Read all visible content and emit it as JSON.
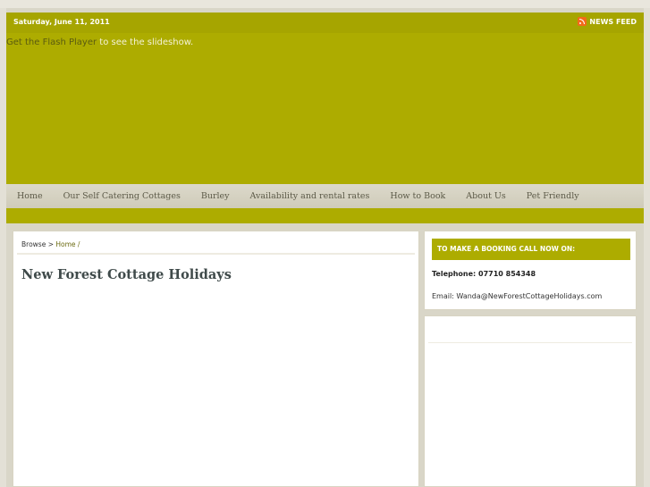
{
  "topbar": {
    "date": "Saturday, June 11, 2011",
    "newsfeed_label": "NEWS FEED"
  },
  "header": {
    "flash_link": "Get the Flash Player",
    "flash_text": " to see the slideshow."
  },
  "nav": {
    "items": [
      "Home",
      "Our Self Catering Cottages",
      "Burley",
      "Availability and rental rates",
      "How to Book",
      "About Us",
      "Pet Friendly"
    ]
  },
  "breadcrumb": {
    "browse": "Browse",
    "separator": " > ",
    "home": "Home",
    "trail": " /"
  },
  "main": {
    "title": "New Forest Cottage Holidays"
  },
  "sidebar": {
    "booking_heading": "TO MAKE A BOOKING CALL NOW ON:",
    "telephone": "Telephone: 07710 854348",
    "email": "Email: Wanda@NewForestCottageHolidays.com"
  },
  "colors": {
    "brand": "#adac00",
    "background": "#d9d6c8",
    "rss": "#f26a1b"
  }
}
